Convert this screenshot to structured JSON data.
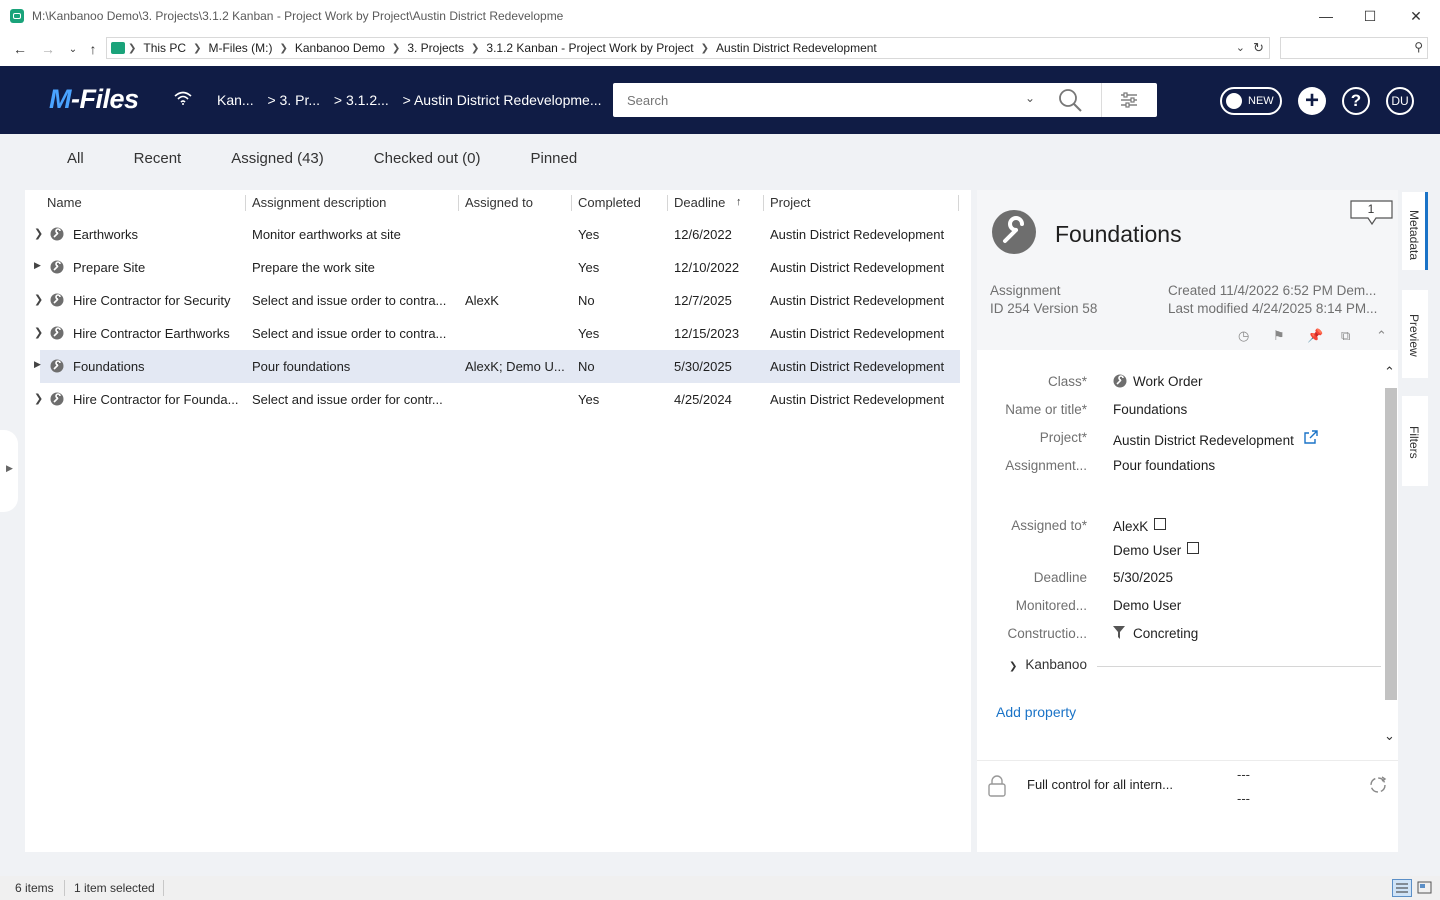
{
  "window": {
    "title": "M:\\Kanbanoo Demo\\3. Projects\\3.1.2 Kanban - Project Work by Project\\Austin District Redevelopme"
  },
  "address": {
    "crumbs": [
      "This PC",
      "M-Files (M:)",
      "Kanbanoo Demo",
      "3. Projects",
      "3.1.2 Kanban - Project Work by Project",
      "Austin District Redevelopment"
    ]
  },
  "header": {
    "logo": "M-Files",
    "crumbs": [
      "Kan...",
      "> 3. Pr...",
      "> 3.1.2...",
      "> Austin District Redevelopme..."
    ],
    "search_placeholder": "Search",
    "new_toggle": "NEW",
    "avatar": "DU"
  },
  "tabs": [
    "All",
    "Recent",
    "Assigned (43)",
    "Checked out (0)",
    "Pinned"
  ],
  "list": {
    "columns": [
      "Name",
      "Assignment description",
      "Assigned to",
      "Completed",
      "Deadline",
      "Project"
    ],
    "rows": [
      {
        "name": "Earthworks",
        "desc": "Monitor earthworks at site",
        "assigned": "",
        "completed": "Yes",
        "deadline": "12/6/2022",
        "project": "Austin District Redevelopment"
      },
      {
        "name": "Prepare Site",
        "desc": "Prepare the work site",
        "assigned": "",
        "completed": "Yes",
        "deadline": "12/10/2022",
        "project": "Austin District Redevelopment"
      },
      {
        "name": "Hire Contractor for Security",
        "desc": "Select and issue order to contra...",
        "assigned": "AlexK",
        "completed": "No",
        "deadline": "12/7/2025",
        "project": "Austin District Redevelopment"
      },
      {
        "name": "Hire Contractor Earthworks",
        "desc": "Select and issue order to contra...",
        "assigned": "",
        "completed": "Yes",
        "deadline": "12/15/2023",
        "project": "Austin District Redevelopment"
      },
      {
        "name": "Foundations",
        "desc": "Pour foundations",
        "assigned": "AlexK; Demo U...",
        "completed": "No",
        "deadline": "5/30/2025",
        "project": "Austin District Redevelopment"
      },
      {
        "name": "Hire Contractor for Founda...",
        "desc": "Select and issue order for contr...",
        "assigned": "",
        "completed": "Yes",
        "deadline": "4/25/2024",
        "project": "Austin District Redevelopment"
      }
    ]
  },
  "meta": {
    "title": "Foundations",
    "comments": "1",
    "type": "Assignment",
    "id_version": "ID 254  Version 58",
    "created": "Created 11/4/2022 6:52 PM Dem...",
    "modified": "Last modified 4/24/2025 8:14 PM...",
    "props": {
      "class_label": "Class",
      "class_value": "Work Order",
      "name_label": "Name or title",
      "name_value": "Foundations",
      "project_label": "Project",
      "project_value": "Austin District Redevelopment",
      "assignment_label": "Assignment...",
      "assignment_value": "Pour foundations",
      "assigned_label": "Assigned to",
      "assigned_1": "AlexK",
      "assigned_2": "Demo User",
      "deadline_label": "Deadline",
      "deadline_value": "5/30/2025",
      "monitored_label": "Monitored...",
      "monitored_value": "Demo User",
      "construction_label": "Constructio...",
      "construction_value": "Concreting"
    },
    "group": "Kanbanoo",
    "add_property": "Add property",
    "permissions": "Full control for all intern...",
    "dash1": "---",
    "dash2": "---"
  },
  "side_tabs": [
    "Metadata",
    "Preview",
    "Filters"
  ],
  "status": {
    "items": "6 items",
    "selected": "1 item selected"
  },
  "colors": {
    "header_bg": "#101c45",
    "accent": "#1a73c7",
    "selected_row": "#e3e8f3"
  }
}
